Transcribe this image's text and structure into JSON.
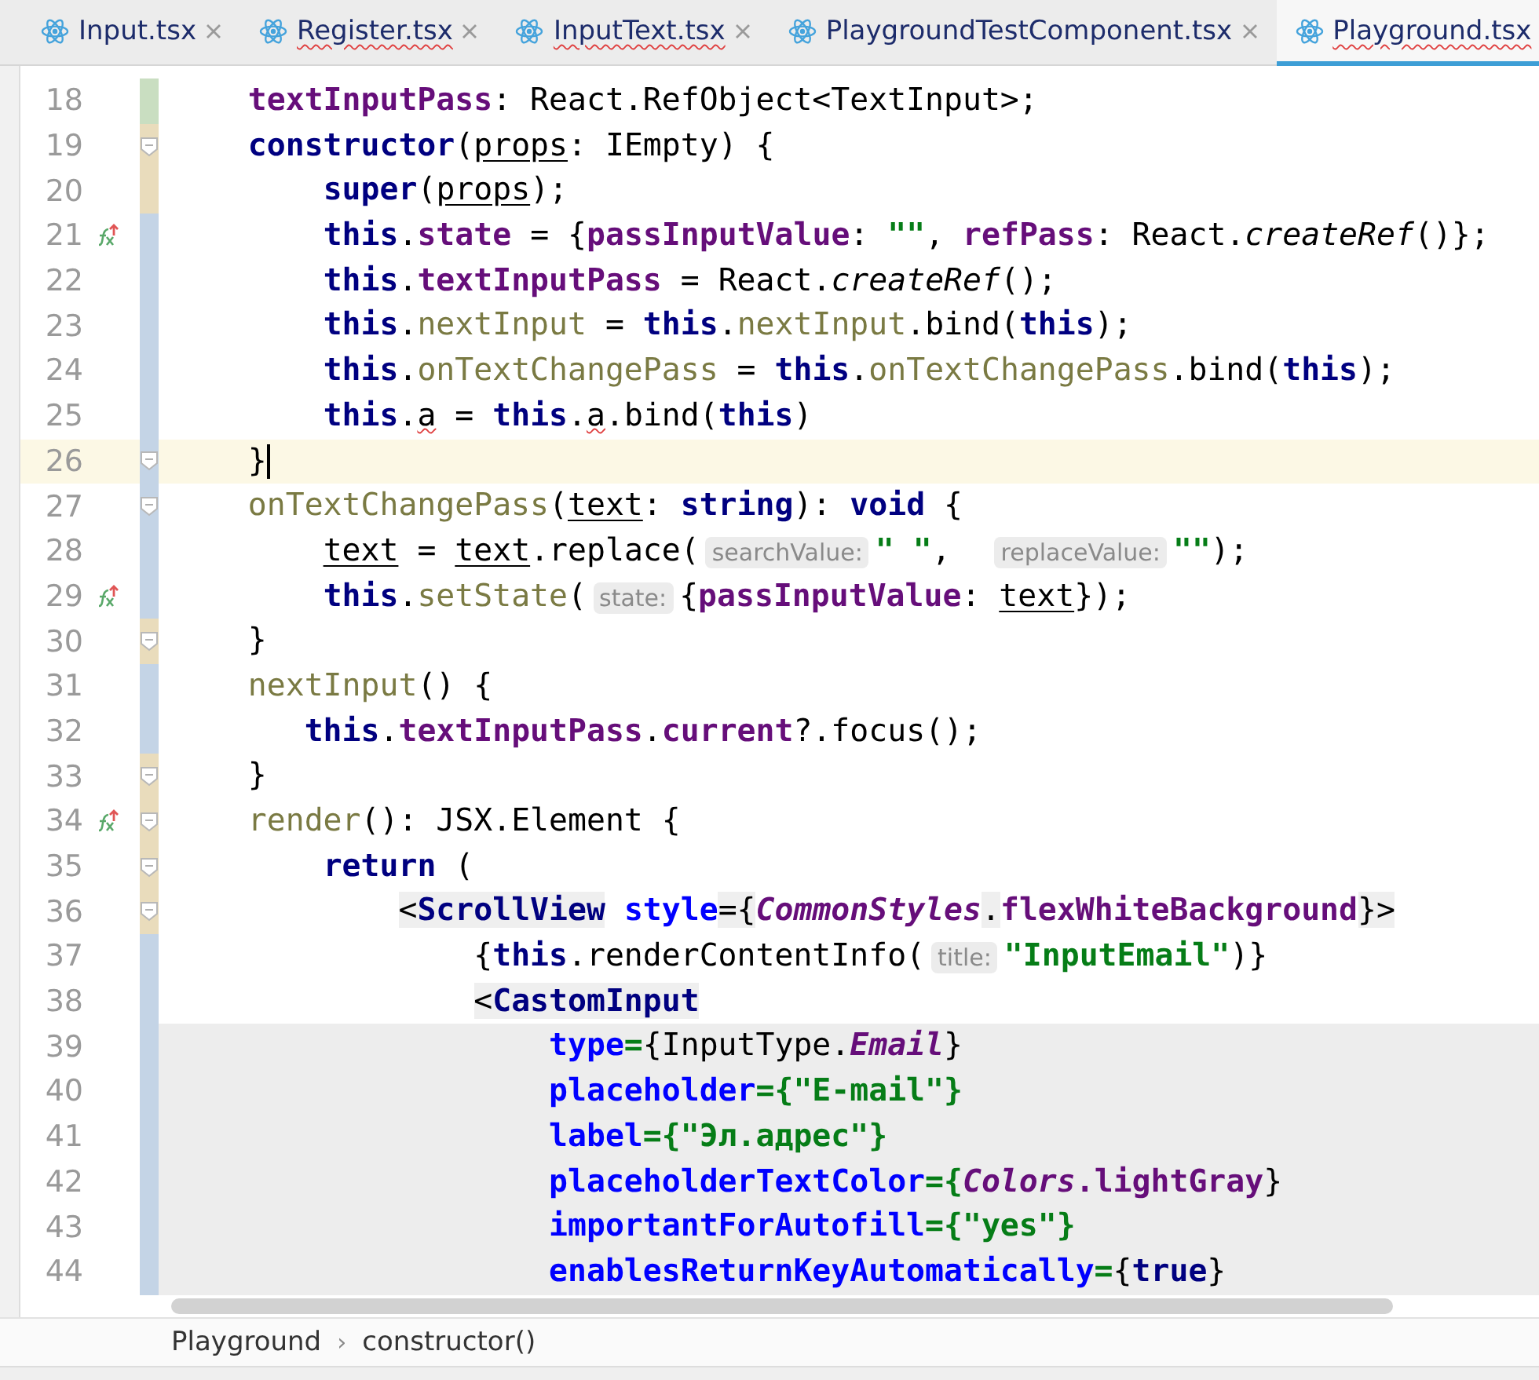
{
  "tabs": [
    {
      "label": "Input.tsx",
      "selected": false,
      "misspelled": false
    },
    {
      "label": "Register.tsx",
      "selected": false,
      "misspelled": true
    },
    {
      "label": "InputText.tsx",
      "selected": false,
      "misspelled": true
    },
    {
      "label": "PlaygroundTestComponent.tsx",
      "selected": false,
      "misspelled": false
    },
    {
      "label": "Playground.tsx",
      "selected": true,
      "misspelled": true
    }
  ],
  "editor": {
    "lines": [
      {
        "number": "18",
        "color": "#c9dec1",
        "fold": false,
        "marker": false,
        "current": false,
        "shaded": false,
        "tokens": [
          {
            "t": "    textInputPass",
            "kind": "field"
          },
          {
            "t": ": React.RefObject<TextInput>;",
            "kind": "plain"
          }
        ]
      },
      {
        "number": "19",
        "color": "#e9dcbc",
        "fold": true,
        "marker": false,
        "current": false,
        "shaded": false,
        "tokens": [
          {
            "t": "    constructor",
            "kind": "kw"
          },
          {
            "t": "(",
            "kind": "plain"
          },
          {
            "t": "props",
            "kind": "param"
          },
          {
            "t": ": IEmpty) {",
            "kind": "plain"
          }
        ]
      },
      {
        "number": "20",
        "color": "#e9dcbc",
        "fold": false,
        "marker": false,
        "current": false,
        "shaded": false,
        "tokens": [
          {
            "t": "        super",
            "kind": "kw"
          },
          {
            "t": "(",
            "kind": "plain"
          },
          {
            "t": "props",
            "kind": "param"
          },
          {
            "t": ");",
            "kind": "plain"
          }
        ]
      },
      {
        "number": "21",
        "color": "#c4d4e6",
        "fold": false,
        "marker": true,
        "current": false,
        "shaded": false,
        "tokens": [
          {
            "t": "        this",
            "kind": "kw"
          },
          {
            "t": ".",
            "kind": "plain"
          },
          {
            "t": "state",
            "kind": "field"
          },
          {
            "t": " = {",
            "kind": "plain"
          },
          {
            "t": "passInputValue",
            "kind": "field"
          },
          {
            "t": ": ",
            "kind": "plain"
          },
          {
            "t": "\"\"",
            "kind": "str"
          },
          {
            "t": ", ",
            "kind": "plain"
          },
          {
            "t": "refPass",
            "kind": "field"
          },
          {
            "t": ": React.",
            "kind": "plain"
          },
          {
            "t": "createRef",
            "kind": "static"
          },
          {
            "t": "()};",
            "kind": "plain"
          }
        ]
      },
      {
        "number": "22",
        "color": "#c4d4e6",
        "fold": false,
        "marker": false,
        "current": false,
        "shaded": false,
        "tokens": [
          {
            "t": "        this",
            "kind": "kw"
          },
          {
            "t": ".",
            "kind": "plain"
          },
          {
            "t": "textInputPass",
            "kind": "field"
          },
          {
            "t": " = React.",
            "kind": "plain"
          },
          {
            "t": "createRef",
            "kind": "static"
          },
          {
            "t": "();",
            "kind": "plain"
          }
        ]
      },
      {
        "number": "23",
        "color": "#c4d4e6",
        "fold": false,
        "marker": false,
        "current": false,
        "shaded": false,
        "tokens": [
          {
            "t": "        this",
            "kind": "kw"
          },
          {
            "t": ".",
            "kind": "plain"
          },
          {
            "t": "nextInput",
            "kind": "method"
          },
          {
            "t": " = ",
            "kind": "plain"
          },
          {
            "t": "this",
            "kind": "kw"
          },
          {
            "t": ".",
            "kind": "plain"
          },
          {
            "t": "nextInput",
            "kind": "method"
          },
          {
            "t": ".bind(",
            "kind": "plain"
          },
          {
            "t": "this",
            "kind": "kw"
          },
          {
            "t": ");",
            "kind": "plain"
          }
        ]
      },
      {
        "number": "24",
        "color": "#c4d4e6",
        "fold": false,
        "marker": false,
        "current": false,
        "shaded": false,
        "tokens": [
          {
            "t": "        this",
            "kind": "kw"
          },
          {
            "t": ".",
            "kind": "plain"
          },
          {
            "t": "onTextChangePass",
            "kind": "method"
          },
          {
            "t": " = ",
            "kind": "plain"
          },
          {
            "t": "this",
            "kind": "kw"
          },
          {
            "t": ".",
            "kind": "plain"
          },
          {
            "t": "onTextChangePass",
            "kind": "method"
          },
          {
            "t": ".bind(",
            "kind": "plain"
          },
          {
            "t": "this",
            "kind": "kw"
          },
          {
            "t": ");",
            "kind": "plain"
          }
        ]
      },
      {
        "number": "25",
        "color": "#c4d4e6",
        "fold": false,
        "marker": false,
        "current": false,
        "shaded": false,
        "tokens": [
          {
            "t": "        this",
            "kind": "kw"
          },
          {
            "t": ".",
            "kind": "plain"
          },
          {
            "t": "a",
            "kind": "typo"
          },
          {
            "t": " = ",
            "kind": "plain"
          },
          {
            "t": "this",
            "kind": "kw"
          },
          {
            "t": ".",
            "kind": "plain"
          },
          {
            "t": "a",
            "kind": "typo"
          },
          {
            "t": ".bind(",
            "kind": "plain"
          },
          {
            "t": "this",
            "kind": "kw"
          },
          {
            "t": ")",
            "kind": "plain"
          }
        ]
      },
      {
        "number": "26",
        "color": "#c4d4e6",
        "fold": true,
        "marker": false,
        "current": true,
        "shaded": false,
        "tokens": [
          {
            "t": "    }",
            "kind": "plain"
          }
        ]
      },
      {
        "number": "27",
        "color": "#c4d4e6",
        "fold": true,
        "marker": false,
        "current": false,
        "shaded": false,
        "tokens": [
          {
            "t": "    onTextChangePass",
            "kind": "method"
          },
          {
            "t": "(",
            "kind": "plain"
          },
          {
            "t": "text",
            "kind": "param"
          },
          {
            "t": ": ",
            "kind": "plain"
          },
          {
            "t": "string",
            "kind": "kw"
          },
          {
            "t": "): ",
            "kind": "plain"
          },
          {
            "t": "void",
            "kind": "kw"
          },
          {
            "t": " {",
            "kind": "plain"
          }
        ]
      },
      {
        "number": "28",
        "color": "#c4d4e6",
        "fold": false,
        "marker": false,
        "current": false,
        "shaded": false,
        "tokens": [
          {
            "t": "        text",
            "kind": "param"
          },
          {
            "t": " = ",
            "kind": "plain"
          },
          {
            "t": "text",
            "kind": "param"
          },
          {
            "t": ".replace(",
            "kind": "plain"
          },
          {
            "t": "searchValue:",
            "kind": "hint"
          },
          {
            "t": "\" \"",
            "kind": "str"
          },
          {
            "t": ",  ",
            "kind": "plain"
          },
          {
            "t": "replaceValue:",
            "kind": "hint"
          },
          {
            "t": "\"\"",
            "kind": "str"
          },
          {
            "t": ");",
            "kind": "plain"
          }
        ]
      },
      {
        "number": "29",
        "color": "#c4d4e6",
        "fold": false,
        "marker": true,
        "current": false,
        "shaded": false,
        "tokens": [
          {
            "t": "        this",
            "kind": "kw"
          },
          {
            "t": ".",
            "kind": "plain"
          },
          {
            "t": "setState",
            "kind": "method"
          },
          {
            "t": "(",
            "kind": "plain"
          },
          {
            "t": "state:",
            "kind": "hint"
          },
          {
            "t": "{",
            "kind": "plain"
          },
          {
            "t": "passInputValue",
            "kind": "field"
          },
          {
            "t": ": ",
            "kind": "plain"
          },
          {
            "t": "text",
            "kind": "param"
          },
          {
            "t": "});",
            "kind": "plain"
          }
        ]
      },
      {
        "number": "30",
        "color": "#e9dcbc",
        "fold": true,
        "marker": false,
        "current": false,
        "shaded": false,
        "tokens": [
          {
            "t": "    }",
            "kind": "plain"
          }
        ]
      },
      {
        "number": "31",
        "color": "#c4d4e6",
        "fold": false,
        "marker": false,
        "current": false,
        "shaded": false,
        "tokens": [
          {
            "t": "    nextInput",
            "kind": "method"
          },
          {
            "t": "() {",
            "kind": "plain"
          }
        ]
      },
      {
        "number": "32",
        "color": "#c4d4e6",
        "fold": false,
        "marker": false,
        "current": false,
        "shaded": false,
        "tokens": [
          {
            "t": "       this",
            "kind": "kw"
          },
          {
            "t": ".",
            "kind": "plain"
          },
          {
            "t": "textInputPass",
            "kind": "field"
          },
          {
            "t": ".",
            "kind": "plain"
          },
          {
            "t": "current",
            "kind": "field"
          },
          {
            "t": "?.focus();",
            "kind": "plain"
          }
        ]
      },
      {
        "number": "33",
        "color": "#e9dcbc",
        "fold": true,
        "marker": false,
        "current": false,
        "shaded": false,
        "tokens": [
          {
            "t": "    }",
            "kind": "plain"
          }
        ]
      },
      {
        "number": "34",
        "color": "#e9dcbc",
        "fold": true,
        "marker": true,
        "current": false,
        "shaded": false,
        "tokens": [
          {
            "t": "    render",
            "kind": "method"
          },
          {
            "t": "(): JSX.Element {",
            "kind": "plain"
          }
        ]
      },
      {
        "number": "35",
        "color": "#e9dcbc",
        "fold": true,
        "marker": false,
        "current": false,
        "shaded": false,
        "tokens": [
          {
            "t": "        return",
            "kind": "kw"
          },
          {
            "t": " (",
            "kind": "plain"
          }
        ]
      },
      {
        "number": "36",
        "color": "#e9dcbc",
        "fold": true,
        "marker": false,
        "current": false,
        "shaded": false,
        "tokens": [
          {
            "t": "            <",
            "kind": "tagbg"
          },
          {
            "t": "ScrollView",
            "kind": "tag"
          },
          {
            "t": " style",
            "kind": "attr"
          },
          {
            "t": "={",
            "kind": "tagbg"
          },
          {
            "t": "CommonStyles",
            "kind": "enum"
          },
          {
            "t": ".",
            "kind": "tagbg"
          },
          {
            "t": "flexWhiteBackground",
            "kind": "enumfield"
          },
          {
            "t": "}>",
            "kind": "tagbg"
          }
        ]
      },
      {
        "number": "37",
        "color": "#c4d4e6",
        "fold": false,
        "marker": false,
        "current": false,
        "shaded": false,
        "tokens": [
          {
            "t": "                {",
            "kind": "plain"
          },
          {
            "t": "this",
            "kind": "kw"
          },
          {
            "t": ".renderContentInfo(",
            "kind": "plain"
          },
          {
            "t": "title:",
            "kind": "hint"
          },
          {
            "t": "\"InputEmail\"",
            "kind": "str"
          },
          {
            "t": ")}",
            "kind": "plain"
          }
        ]
      },
      {
        "number": "38",
        "color": "#c4d4e6",
        "fold": false,
        "marker": false,
        "current": false,
        "shaded": false,
        "tokens": [
          {
            "t": "                <",
            "kind": "tagbg"
          },
          {
            "t": "CastomInput",
            "kind": "tag"
          }
        ]
      },
      {
        "number": "39",
        "color": "#c4d4e6",
        "fold": false,
        "marker": false,
        "current": false,
        "shaded": true,
        "tokens": [
          {
            "t": "                    type",
            "kind": "attr"
          },
          {
            "t": "=",
            "kind": "attrstr"
          },
          {
            "t": "{InputType.",
            "kind": "plain"
          },
          {
            "t": "Email",
            "kind": "enumitalic"
          },
          {
            "t": "}",
            "kind": "plain"
          }
        ]
      },
      {
        "number": "40",
        "color": "#c4d4e6",
        "fold": false,
        "marker": false,
        "current": false,
        "shaded": true,
        "tokens": [
          {
            "t": "                    placeholder",
            "kind": "attr"
          },
          {
            "t": "={\"E-mail\"}",
            "kind": "attrstr"
          }
        ]
      },
      {
        "number": "41",
        "color": "#c4d4e6",
        "fold": false,
        "marker": false,
        "current": false,
        "shaded": true,
        "tokens": [
          {
            "t": "                    label",
            "kind": "attr"
          },
          {
            "t": "={\"Эл.адрес\"}",
            "kind": "attrstr"
          }
        ]
      },
      {
        "number": "42",
        "color": "#c4d4e6",
        "fold": false,
        "marker": false,
        "current": false,
        "shaded": true,
        "tokens": [
          {
            "t": "                    placeholderTextColor",
            "kind": "attr"
          },
          {
            "t": "={",
            "kind": "attrstr"
          },
          {
            "t": "Colors",
            "kind": "enum"
          },
          {
            "t": ".lightGray",
            "kind": "enumfield"
          },
          {
            "t": "}",
            "kind": "plain"
          }
        ]
      },
      {
        "number": "43",
        "color": "#c4d4e6",
        "fold": false,
        "marker": false,
        "current": false,
        "shaded": true,
        "tokens": [
          {
            "t": "                    importantForAutofill",
            "kind": "attr"
          },
          {
            "t": "={\"yes\"}",
            "kind": "attrstr"
          }
        ]
      },
      {
        "number": "44",
        "color": "#c4d4e6",
        "fold": false,
        "marker": false,
        "current": false,
        "shaded": true,
        "tokens": [
          {
            "t": "                    enablesReturnKeyAutomatically",
            "kind": "attr"
          },
          {
            "t": "=",
            "kind": "attrstr"
          },
          {
            "t": "{",
            "kind": "plain"
          },
          {
            "t": "true",
            "kind": "kw"
          },
          {
            "t": "}",
            "kind": "plain"
          }
        ]
      }
    ]
  },
  "breadcrumbs": {
    "items": [
      "Playground",
      "constructor()"
    ],
    "separator": "›"
  }
}
